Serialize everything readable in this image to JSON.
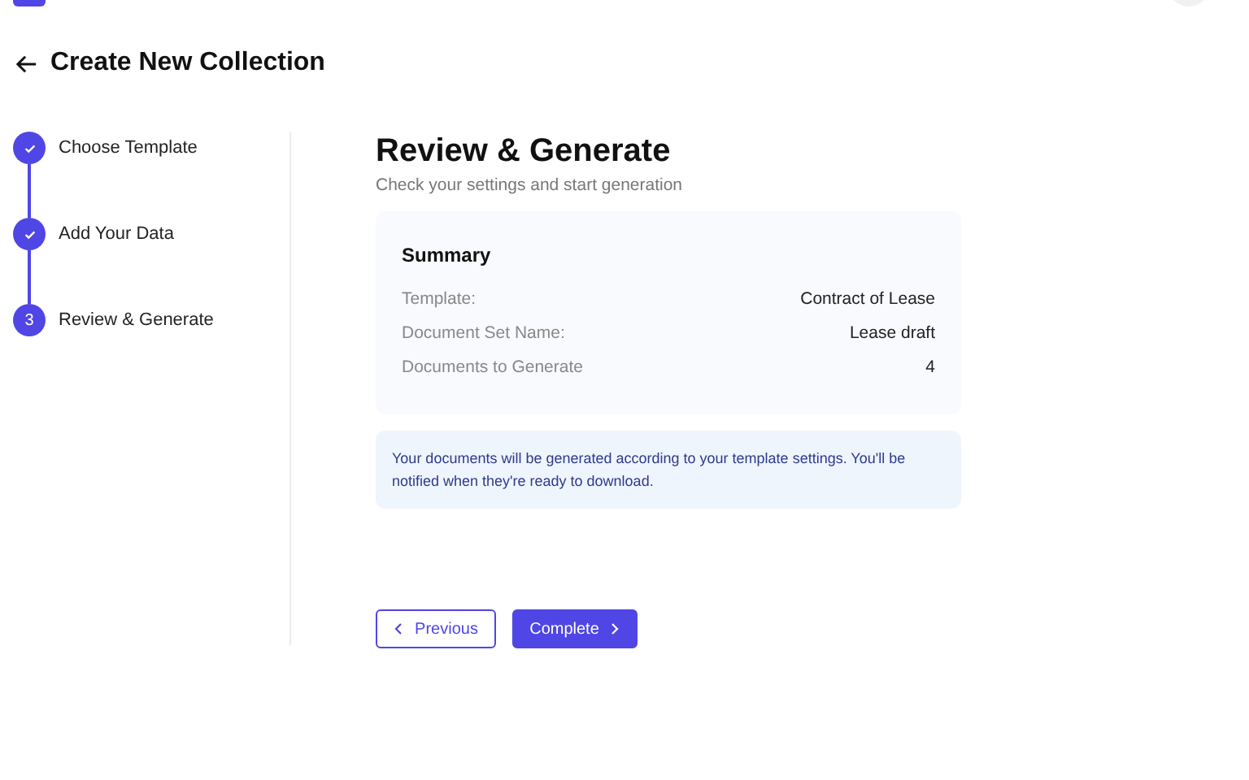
{
  "header": {
    "title": "Create New Collection"
  },
  "steps": [
    {
      "label": "Choose Template",
      "kind": "done"
    },
    {
      "label": "Add Your Data",
      "kind": "done"
    },
    {
      "label": "Review & Generate",
      "kind": "current",
      "number": "3"
    }
  ],
  "main": {
    "title": "Review & Generate",
    "subtitle": "Check your settings and start generation"
  },
  "summary": {
    "title": "Summary",
    "rows": [
      {
        "label": "Template:",
        "value": "Contract of Lease"
      },
      {
        "label": "Document Set Name:",
        "value": "Lease draft"
      },
      {
        "label": "Documents to Generate",
        "value": "4"
      }
    ]
  },
  "notice": "Your documents will be generated according to your template settings. You'll be notified when they're ready to download.",
  "buttons": [
    {
      "label": "Previous",
      "kind": "secondary"
    },
    {
      "label": "Complete",
      "kind": "primary"
    }
  ]
}
